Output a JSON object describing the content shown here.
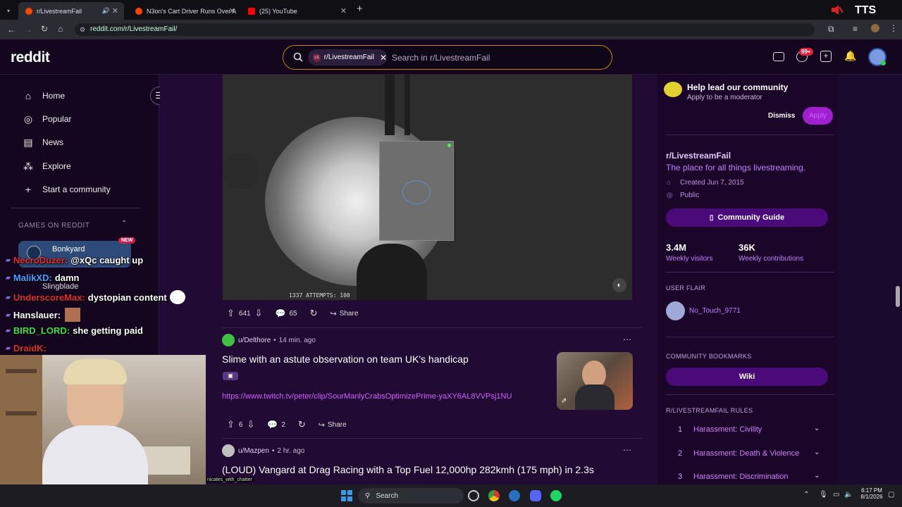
{
  "browser": {
    "tabs": [
      {
        "label": "r/LivestreamFail",
        "active": true
      },
      {
        "label": "N3on's Cart Driver Runs Over A",
        "active": false
      },
      {
        "label": "(25) YouTube",
        "active": false
      }
    ],
    "url": "reddit.com/r/LivestreamFail/",
    "overlay_brand": "TTS"
  },
  "header": {
    "logo": "reddit",
    "search_chip": "r/LivestreamFail",
    "search_chip_icon_text": "LS",
    "search_placeholder": "Search in r/LivestreamFail",
    "notification_badge": "99+"
  },
  "sidebar": {
    "items": [
      {
        "label": "Home",
        "icon": "home-icon"
      },
      {
        "label": "Popular",
        "icon": "popular-icon"
      },
      {
        "label": "News",
        "icon": "news-icon"
      },
      {
        "label": "Explore",
        "icon": "explore-icon"
      },
      {
        "label": "Start a community",
        "icon": "plus-icon"
      }
    ],
    "section_title": "GAMES ON REDDIT",
    "games": [
      {
        "label": "Bonkyard",
        "badge": "NEW"
      },
      {
        "label": "Slingblade"
      }
    ]
  },
  "video": {
    "hud_text": "1337 ATTEMPTS: 100"
  },
  "posts": [
    {
      "votes": "641",
      "comments": "65",
      "share_label": "Share"
    },
    {
      "author": "u/Delthore",
      "time": "14 min. ago",
      "title": "Slime with an astute observation on team UK's handicap",
      "link": "https://www.twitch.tv/peter/clip/SourManlyCrabsOptimizePrime-yaXY6AL8VVPsj1NU",
      "votes": "6",
      "comments": "2",
      "share_label": "Share"
    },
    {
      "author": "u/Mazpen",
      "time": "2 hr. ago",
      "title": "(LOUD) Vangard at Drag Racing with a Top Fuel 12,000hp 282kmh (175 mph) in 2.3s"
    }
  ],
  "right_sidebar": {
    "mod_title": "Help lead our community",
    "mod_sub": "Apply to be a moderator",
    "dismiss": "Dismiss",
    "apply": "Apply",
    "sub_name": "r/LivestreamFail",
    "sub_desc": "The place for all things livestreaming.",
    "created": "Created Jun 7, 2015",
    "visibility": "Public",
    "guide_button": "Community Guide",
    "stats": [
      {
        "value": "3.4M",
        "label": "Weekly visitors"
      },
      {
        "value": "36K",
        "label": "Weekly contributions"
      }
    ],
    "user_flair_title": "USER FLAIR",
    "user_flair_name": "No_Touch_9771",
    "bookmarks_title": "COMMUNITY BOOKMARKS",
    "bookmark": "Wiki",
    "rules_title": "R/LIVESTREAMFAIL RULES",
    "rules": [
      {
        "n": "1",
        "label": "Harassment: Civility"
      },
      {
        "n": "2",
        "label": "Harassment: Death & Violence"
      },
      {
        "n": "3",
        "label": "Harassment: Discrimination"
      }
    ]
  },
  "chat_overlay": [
    {
      "name": "NecroDuzer:",
      "text": "@xQc caught up",
      "color": "#e03030"
    },
    {
      "name": "MalikXD:",
      "text": "damn",
      "color": "#40a0ff"
    },
    {
      "name": "UnderscoreMax:",
      "text": "dystopian content",
      "color": "#e03030"
    },
    {
      "name": "Hanslauer:",
      "text": "",
      "color": "#ffffff"
    },
    {
      "name": "BIRD_LORD:",
      "text": "she getting paid",
      "color": "#40e040"
    },
    {
      "name": "DraidK:",
      "text": "",
      "color": "#e03030"
    }
  ],
  "stream_caption": "nicates_with_chatter",
  "taskbar": {
    "search": "Search",
    "time": "6:17 PM",
    "date": "8/1/2026"
  }
}
